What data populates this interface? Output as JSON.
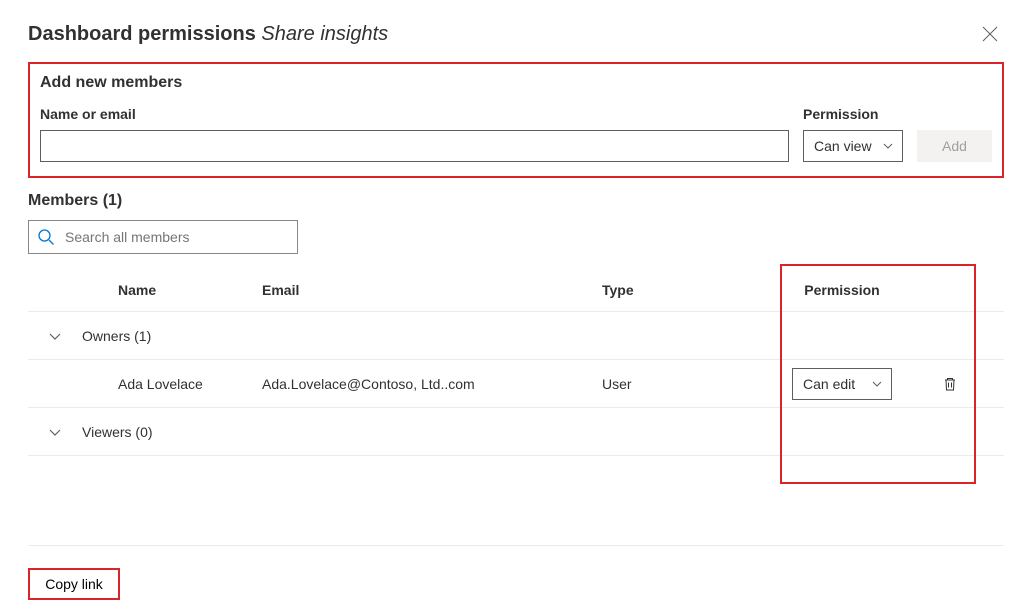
{
  "header": {
    "title_prefix": "Dashboard permissions ",
    "title_italic": "Share insights"
  },
  "add_section": {
    "heading": "Add new members",
    "name_label": "Name or email",
    "permission_label": "Permission",
    "permission_value": "Can view",
    "add_button": "Add"
  },
  "members": {
    "heading": "Members (1)",
    "search_placeholder": "Search all members",
    "columns": {
      "name": "Name",
      "email": "Email",
      "type": "Type",
      "permission": "Permission"
    },
    "groups": [
      {
        "label": "Owners (1)",
        "rows": [
          {
            "name": "Ada Lovelace",
            "email": "Ada.Lovelace@Contoso, Ltd..com",
            "type": "User",
            "permission": "Can edit"
          }
        ]
      },
      {
        "label": "Viewers (0)",
        "rows": []
      }
    ]
  },
  "footer": {
    "copy_link": "Copy link"
  }
}
